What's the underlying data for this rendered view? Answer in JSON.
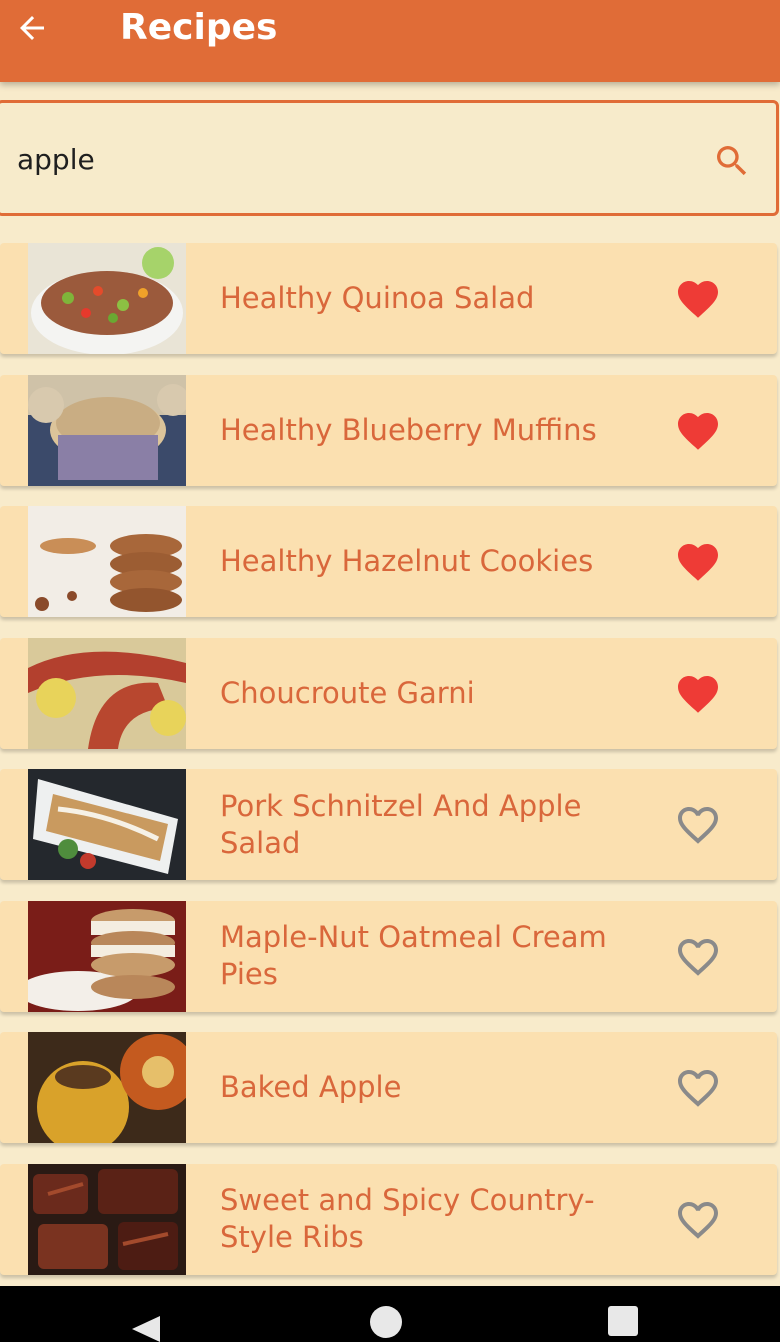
{
  "appbar": {
    "title": "Recipes"
  },
  "search": {
    "value": "apple",
    "placeholder": ""
  },
  "colors": {
    "primary": "#e06c37",
    "background": "#f8ebcb",
    "card": "#fbe0b0",
    "title_text": "#d9673b",
    "favorite_filled": "#ee3b36",
    "favorite_outline": "#8a8a8a"
  },
  "recipes": [
    {
      "title": "Healthy Quinoa Salad",
      "favorite": true,
      "image": "quinoa-salad-thumbnail"
    },
    {
      "title": "Healthy Blueberry Muffins",
      "favorite": true,
      "image": "blueberry-muffins-thumbnail"
    },
    {
      "title": "Healthy Hazelnut Cookies",
      "favorite": true,
      "image": "hazelnut-cookies-thumbnail"
    },
    {
      "title": "Choucroute Garni",
      "favorite": true,
      "image": "choucroute-thumbnail"
    },
    {
      "title": "Pork Schnitzel And Apple Salad",
      "favorite": false,
      "image": "pork-schnitzel-thumbnail"
    },
    {
      "title": "Maple-Nut Oatmeal Cream Pies",
      "favorite": false,
      "image": "oatmeal-cream-pies-thumbnail"
    },
    {
      "title": "Baked Apple",
      "favorite": false,
      "image": "baked-apple-thumbnail"
    },
    {
      "title": "Sweet and Spicy Country-Style Ribs",
      "favorite": false,
      "image": "ribs-thumbnail"
    }
  ]
}
